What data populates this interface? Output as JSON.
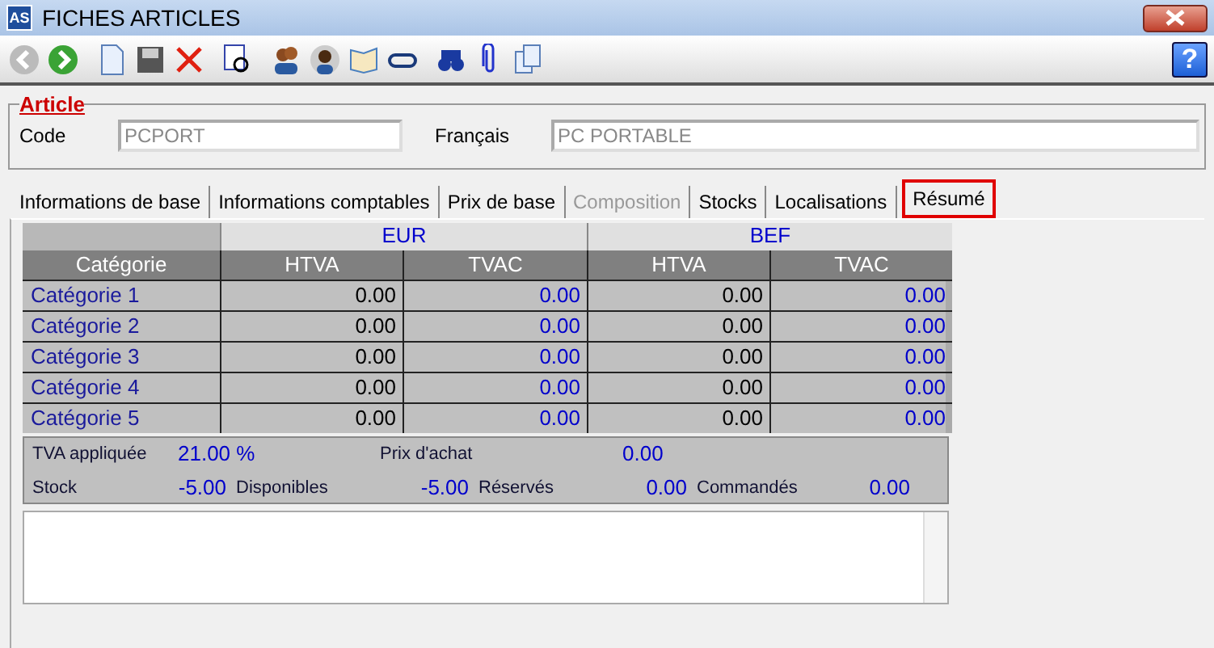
{
  "window": {
    "title": "FICHES ARTICLES",
    "logo": "AS"
  },
  "help": "?",
  "article": {
    "legend": "Article",
    "fields": [
      {
        "label": "Code",
        "value": "PCPORT"
      },
      {
        "label": "Français",
        "value": "PC PORTABLE"
      }
    ]
  },
  "tabs": [
    {
      "label": "Informations de base",
      "selected": false,
      "disabled": false
    },
    {
      "label": "Informations comptables",
      "selected": false,
      "disabled": false
    },
    {
      "label": "Prix de base",
      "selected": false,
      "disabled": false
    },
    {
      "label": "Composition",
      "selected": false,
      "disabled": true
    },
    {
      "label": "Stocks",
      "selected": false,
      "disabled": false
    },
    {
      "label": "Localisations",
      "selected": false,
      "disabled": false
    },
    {
      "label": "Résumé",
      "selected": true,
      "disabled": false
    }
  ],
  "table": {
    "currencies": [
      "EUR",
      "BEF"
    ],
    "category_header": "Catégorie",
    "sub_columns": [
      "HTVA",
      "TVAC",
      "HTVA",
      "TVAC"
    ],
    "rows": [
      {
        "name": "Catégorie 1",
        "values": [
          "0.00",
          "0.00",
          "0.00",
          "0.00"
        ]
      },
      {
        "name": "Catégorie 2",
        "values": [
          "0.00",
          "0.00",
          "0.00",
          "0.00"
        ]
      },
      {
        "name": "Catégorie 3",
        "values": [
          "0.00",
          "0.00",
          "0.00",
          "0.00"
        ]
      },
      {
        "name": "Catégorie 4",
        "values": [
          "0.00",
          "0.00",
          "0.00",
          "0.00"
        ]
      },
      {
        "name": "Catégorie 5",
        "values": [
          "0.00",
          "0.00",
          "0.00",
          "0.00"
        ]
      }
    ]
  },
  "summary": {
    "tva_label": "TVA appliquée",
    "tva": "21.00 %",
    "purchase_label": "Prix d'achat",
    "purchase": "0.00",
    "stock": [
      {
        "label": "Stock",
        "value": "-5.00"
      },
      {
        "label": "Disponibles",
        "value": "-5.00"
      },
      {
        "label": "Réservés",
        "value": "0.00"
      },
      {
        "label": "Commandés",
        "value": "0.00"
      }
    ]
  }
}
